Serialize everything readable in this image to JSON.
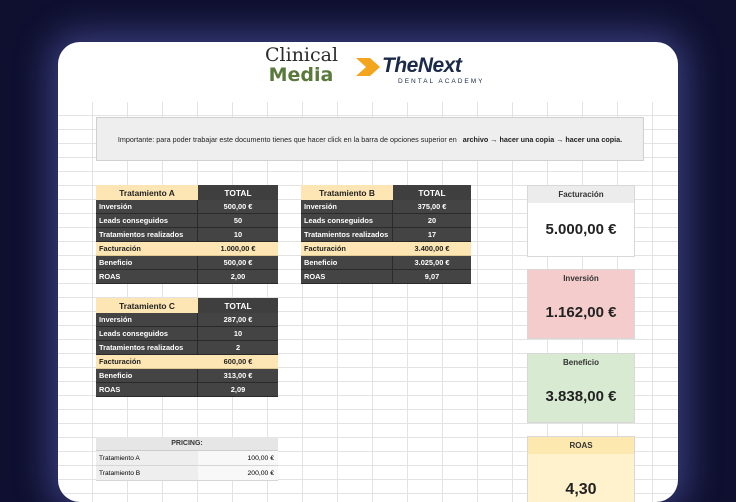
{
  "logos": {
    "clinical_line1": "Clinical",
    "clinical_line2": "Media",
    "thenext_name": "TheNext",
    "thenext_tagline": "DENTAL ACADEMY"
  },
  "notice": {
    "text": "Importante: para poder trabajar este documento tienes que hacer click en la barra de opciones superior en",
    "path": "archivo → hacer una copia → hacer una copia."
  },
  "labels": {
    "total": "TOTAL",
    "inversion": "Inversión",
    "leads": "Leads conseguidos",
    "tratamientos": "Tratamientos realizados",
    "facturacion": "Facturación",
    "beneficio": "Beneficio",
    "roas": "ROAS"
  },
  "tables": [
    {
      "title": "Tratamiento A",
      "inversion": "500,00 €",
      "leads": "50",
      "tratamientos": "10",
      "facturacion": "1.000,00 €",
      "beneficio": "500,00 €",
      "roas": "2,00"
    },
    {
      "title": "Tratamiento B",
      "inversion": "375,00 €",
      "leads": "20",
      "tratamientos": "17",
      "facturacion": "3.400,00 €",
      "beneficio": "3.025,00 €",
      "roas": "9,07"
    },
    {
      "title": "Tratamiento C",
      "inversion": "287,00 €",
      "leads": "10",
      "tratamientos": "2",
      "facturacion": "600,00 €",
      "beneficio": "313,00 €",
      "roas": "2,09"
    }
  ],
  "kpis": {
    "facturacion": {
      "label": "Facturación",
      "value": "5.000,00 €"
    },
    "inversion": {
      "label": "Inversión",
      "value": "1.162,00 €"
    },
    "beneficio": {
      "label": "Beneficio",
      "value": "3.838,00 €"
    },
    "roas": {
      "label": "ROAS",
      "value": "4,30"
    }
  },
  "pricing": {
    "title": "PRICING:",
    "rows": [
      {
        "label": "Tratamiento A",
        "value": "100,00 €"
      },
      {
        "label": "Tratamiento B",
        "value": "200,00 €"
      }
    ]
  },
  "colors": {
    "background": "#0f1030",
    "header_yellow": "#fde6b3",
    "dark_cell": "#444444",
    "kpi_inversion": "#f4cccc",
    "kpi_beneficio": "#d9ead3",
    "kpi_roas": "#fff2cc",
    "clinical_green": "#5a7a3c",
    "thenext_orange": "#f2a51d"
  }
}
